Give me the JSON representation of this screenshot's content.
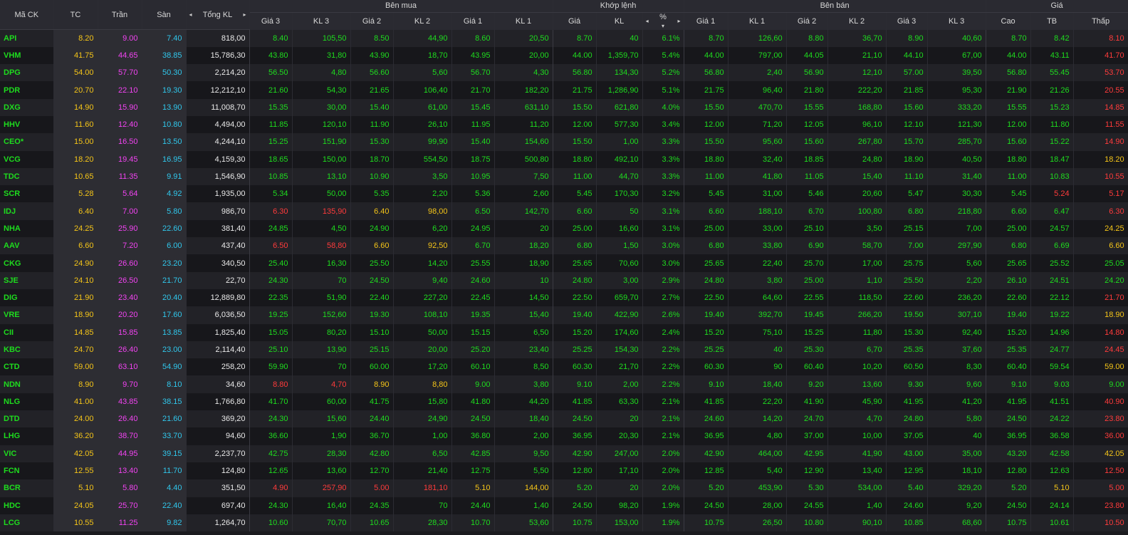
{
  "groups": {
    "ben_mua": "Bên mua",
    "khop_lenh": "Khớp lệnh",
    "ben_ban": "Bên bán",
    "gia": "Giá"
  },
  "headers": {
    "ma": "Mã CK",
    "tc": "TC",
    "tran": "Trần",
    "san": "Sàn",
    "tongkl": "Tổng KL",
    "b_g3": "Giá 3",
    "b_kl3": "KL 3",
    "b_g2": "Giá 2",
    "b_kl2": "KL 2",
    "b_g1": "Giá 1",
    "b_kl1": "KL 1",
    "m_gia": "Giá",
    "m_kl": "KL",
    "m_pct": "%",
    "s_g1": "Giá 1",
    "s_kl1": "KL 1",
    "s_g2": "Giá 2",
    "s_kl2": "KL 2",
    "s_g3": "Giá 3",
    "s_kl3": "KL 3",
    "cao": "Cao",
    "tb": "TB",
    "thap": "Thấp"
  },
  "icons": {
    "arrow_left": "◂",
    "arrow_right": "▸",
    "sort_down": "▾"
  },
  "colors": {
    "up": "#1edc1e",
    "ref": "#f5c518",
    "down": "#ff3b3b",
    "ceil": "#f243f2",
    "floor": "#30c7ec"
  },
  "rows": [
    [
      "API",
      "8.20",
      "9.00",
      "7.40",
      "818,00",
      "8.40",
      "105,50",
      "8.50",
      "44,90",
      "8.60",
      "20,50",
      "8.70",
      "40",
      "6.1%",
      "8.70",
      "126,60",
      "8.80",
      "36,70",
      "8.90",
      "40,60",
      "8.70",
      "8.42",
      "8.10"
    ],
    [
      "VHM",
      "41.75",
      "44.65",
      "38.85",
      "15,786,30",
      "43.80",
      "31,80",
      "43.90",
      "18,70",
      "43.95",
      "20,00",
      "44.00",
      "1,359,70",
      "5.4%",
      "44.00",
      "797,00",
      "44.05",
      "21,10",
      "44.10",
      "67,00",
      "44.00",
      "43.11",
      "41.70"
    ],
    [
      "DPG",
      "54.00",
      "57.70",
      "50.30",
      "2,214,20",
      "56.50",
      "4,80",
      "56.60",
      "5,60",
      "56.70",
      "4,30",
      "56.80",
      "134,30",
      "5.2%",
      "56.80",
      "2,40",
      "56.90",
      "12,10",
      "57.00",
      "39,50",
      "56.80",
      "55.45",
      "53.70"
    ],
    [
      "PDR",
      "20.70",
      "22.10",
      "19.30",
      "12,212,10",
      "21.60",
      "54,30",
      "21.65",
      "106,40",
      "21.70",
      "182,20",
      "21.75",
      "1,286,90",
      "5.1%",
      "21.75",
      "96,40",
      "21.80",
      "222,20",
      "21.85",
      "95,30",
      "21.90",
      "21.26",
      "20.55"
    ],
    [
      "DXG",
      "14.90",
      "15.90",
      "13.90",
      "11,008,70",
      "15.35",
      "30,00",
      "15.40",
      "61,00",
      "15.45",
      "631,10",
      "15.50",
      "621,80",
      "4.0%",
      "15.50",
      "470,70",
      "15.55",
      "168,80",
      "15.60",
      "333,20",
      "15.55",
      "15.23",
      "14.85"
    ],
    [
      "HHV",
      "11.60",
      "12.40",
      "10.80",
      "4,494,00",
      "11.85",
      "120,10",
      "11.90",
      "26,10",
      "11.95",
      "11,20",
      "12.00",
      "577,30",
      "3.4%",
      "12.00",
      "71,20",
      "12.05",
      "96,10",
      "12.10",
      "121,30",
      "12.00",
      "11.80",
      "11.55"
    ],
    [
      "CEO*",
      "15.00",
      "16.50",
      "13.50",
      "4,244,10",
      "15.25",
      "151,90",
      "15.30",
      "99,90",
      "15.40",
      "154,60",
      "15.50",
      "1,00",
      "3.3%",
      "15.50",
      "95,60",
      "15.60",
      "267,80",
      "15.70",
      "285,70",
      "15.60",
      "15.22",
      "14.90"
    ],
    [
      "VCG",
      "18.20",
      "19.45",
      "16.95",
      "4,159,30",
      "18.65",
      "150,00",
      "18.70",
      "554,50",
      "18.75",
      "500,80",
      "18.80",
      "492,10",
      "3.3%",
      "18.80",
      "32,40",
      "18.85",
      "24,80",
      "18.90",
      "40,50",
      "18.80",
      "18.47",
      "18.20"
    ],
    [
      "TDC",
      "10.65",
      "11.35",
      "9.91",
      "1,546,90",
      "10.85",
      "13,10",
      "10.90",
      "3,50",
      "10.95",
      "7,50",
      "11.00",
      "44,70",
      "3.3%",
      "11.00",
      "41,80",
      "11.05",
      "15,40",
      "11.10",
      "31,40",
      "11.00",
      "10.83",
      "10.55"
    ],
    [
      "SCR",
      "5.28",
      "5.64",
      "4.92",
      "1,935,00",
      "5.34",
      "50,00",
      "5.35",
      "2,20",
      "5.36",
      "2,60",
      "5.45",
      "170,30",
      "3.2%",
      "5.45",
      "31,00",
      "5.46",
      "20,60",
      "5.47",
      "30,30",
      "5.45",
      "5.24",
      "5.17"
    ],
    [
      "IDJ",
      "6.40",
      "7.00",
      "5.80",
      "986,70",
      "6.30",
      "135,90",
      "6.40",
      "98,00",
      "6.50",
      "142,70",
      "6.60",
      "50",
      "3.1%",
      "6.60",
      "188,10",
      "6.70",
      "100,80",
      "6.80",
      "218,80",
      "6.60",
      "6.47",
      "6.30"
    ],
    [
      "NHA",
      "24.25",
      "25.90",
      "22.60",
      "381,40",
      "24.85",
      "4,50",
      "24.90",
      "6,20",
      "24.95",
      "20",
      "25.00",
      "16,60",
      "3.1%",
      "25.00",
      "33,00",
      "25.10",
      "3,50",
      "25.15",
      "7,00",
      "25.00",
      "24.57",
      "24.25"
    ],
    [
      "AAV",
      "6.60",
      "7.20",
      "6.00",
      "437,40",
      "6.50",
      "58,80",
      "6.60",
      "92,50",
      "6.70",
      "18,20",
      "6.80",
      "1,50",
      "3.0%",
      "6.80",
      "33,80",
      "6.90",
      "58,70",
      "7.00",
      "297,90",
      "6.80",
      "6.69",
      "6.60"
    ],
    [
      "CKG",
      "24.90",
      "26.60",
      "23.20",
      "340,50",
      "25.40",
      "16,30",
      "25.50",
      "14,20",
      "25.55",
      "18,90",
      "25.65",
      "70,60",
      "3.0%",
      "25.65",
      "22,40",
      "25.70",
      "17,00",
      "25.75",
      "5,60",
      "25.65",
      "25.52",
      "25.05"
    ],
    [
      "SJE",
      "24.10",
      "26.50",
      "21.70",
      "22,70",
      "24.30",
      "70",
      "24.50",
      "9,40",
      "24.60",
      "10",
      "24.80",
      "3,00",
      "2.9%",
      "24.80",
      "3,80",
      "25.00",
      "1,10",
      "25.50",
      "2,20",
      "26.10",
      "24.51",
      "24.20"
    ],
    [
      "DIG",
      "21.90",
      "23.40",
      "20.40",
      "12,889,80",
      "22.35",
      "51,90",
      "22.40",
      "227,20",
      "22.45",
      "14,50",
      "22.50",
      "659,70",
      "2.7%",
      "22.50",
      "64,60",
      "22.55",
      "118,50",
      "22.60",
      "236,20",
      "22.60",
      "22.12",
      "21.70"
    ],
    [
      "VRE",
      "18.90",
      "20.20",
      "17.60",
      "6,036,50",
      "19.25",
      "152,60",
      "19.30",
      "108,10",
      "19.35",
      "15,40",
      "19.40",
      "422,90",
      "2.6%",
      "19.40",
      "392,70",
      "19.45",
      "266,20",
      "19.50",
      "307,10",
      "19.40",
      "19.22",
      "18.90"
    ],
    [
      "CII",
      "14.85",
      "15.85",
      "13.85",
      "1,825,40",
      "15.05",
      "80,20",
      "15.10",
      "50,00",
      "15.15",
      "6,50",
      "15.20",
      "174,60",
      "2.4%",
      "15.20",
      "75,10",
      "15.25",
      "11,80",
      "15.30",
      "92,40",
      "15.20",
      "14.96",
      "14.80"
    ],
    [
      "KBC",
      "24.70",
      "26.40",
      "23.00",
      "2,114,40",
      "25.10",
      "13,90",
      "25.15",
      "20,00",
      "25.20",
      "23,40",
      "25.25",
      "154,30",
      "2.2%",
      "25.25",
      "40",
      "25.30",
      "6,70",
      "25.35",
      "37,60",
      "25.35",
      "24.77",
      "24.45"
    ],
    [
      "CTD",
      "59.00",
      "63.10",
      "54.90",
      "258,20",
      "59.90",
      "70",
      "60.00",
      "17,20",
      "60.10",
      "8,50",
      "60.30",
      "21,70",
      "2.2%",
      "60.30",
      "90",
      "60.40",
      "10,20",
      "60.50",
      "8,30",
      "60.40",
      "59.54",
      "59.00"
    ],
    [
      "NDN",
      "8.90",
      "9.70",
      "8.10",
      "34,60",
      "8.80",
      "4,70",
      "8.90",
      "8,80",
      "9.00",
      "3,80",
      "9.10",
      "2,00",
      "2.2%",
      "9.10",
      "18,40",
      "9.20",
      "13,60",
      "9.30",
      "9,60",
      "9.10",
      "9.03",
      "9.00"
    ],
    [
      "NLG",
      "41.00",
      "43.85",
      "38.15",
      "1,766,80",
      "41.70",
      "60,00",
      "41.75",
      "15,80",
      "41.80",
      "44,20",
      "41.85",
      "63,30",
      "2.1%",
      "41.85",
      "22,20",
      "41.90",
      "45,90",
      "41.95",
      "41,20",
      "41.95",
      "41.51",
      "40.90"
    ],
    [
      "DTD",
      "24.00",
      "26.40",
      "21.60",
      "369,20",
      "24.30",
      "15,60",
      "24.40",
      "24,90",
      "24.50",
      "18,40",
      "24.50",
      "20",
      "2.1%",
      "24.60",
      "14,20",
      "24.70",
      "4,70",
      "24.80",
      "5,80",
      "24.50",
      "24.22",
      "23.80"
    ],
    [
      "LHG",
      "36.20",
      "38.70",
      "33.70",
      "94,60",
      "36.60",
      "1,90",
      "36.70",
      "1,00",
      "36.80",
      "2,00",
      "36.95",
      "20,30",
      "2.1%",
      "36.95",
      "4,80",
      "37.00",
      "10,00",
      "37.05",
      "40",
      "36.95",
      "36.58",
      "36.00"
    ],
    [
      "VIC",
      "42.05",
      "44.95",
      "39.15",
      "2,237,70",
      "42.75",
      "28,30",
      "42.80",
      "6,50",
      "42.85",
      "9,50",
      "42.90",
      "247,00",
      "2.0%",
      "42.90",
      "464,00",
      "42.95",
      "41,90",
      "43.00",
      "35,00",
      "43.20",
      "42.58",
      "42.05"
    ],
    [
      "FCN",
      "12.55",
      "13.40",
      "11.70",
      "124,80",
      "12.65",
      "13,60",
      "12.70",
      "21,40",
      "12.75",
      "5,50",
      "12.80",
      "17,10",
      "2.0%",
      "12.85",
      "5,40",
      "12.90",
      "13,40",
      "12.95",
      "18,10",
      "12.80",
      "12.63",
      "12.50"
    ],
    [
      "BCR",
      "5.10",
      "5.80",
      "4.40",
      "351,50",
      "4.90",
      "257,90",
      "5.00",
      "181,10",
      "5.10",
      "144,00",
      "5.20",
      "20",
      "2.0%",
      "5.20",
      "453,90",
      "5.30",
      "534,00",
      "5.40",
      "329,20",
      "5.20",
      "5.10",
      "5.00"
    ],
    [
      "HDC",
      "24.05",
      "25.70",
      "22.40",
      "697,40",
      "24.30",
      "16,40",
      "24.35",
      "70",
      "24.40",
      "1,40",
      "24.50",
      "98,20",
      "1.9%",
      "24.50",
      "28,00",
      "24.55",
      "1,40",
      "24.60",
      "9,20",
      "24.50",
      "24.14",
      "23.80"
    ],
    [
      "LCG",
      "10.55",
      "11.25",
      "9.82",
      "1,264,70",
      "10.60",
      "70,70",
      "10.65",
      "28,30",
      "10.70",
      "53,60",
      "10.75",
      "153,00",
      "1.9%",
      "10.75",
      "26,50",
      "10.80",
      "90,10",
      "10.85",
      "68,60",
      "10.75",
      "10.61",
      "10.50"
    ]
  ]
}
